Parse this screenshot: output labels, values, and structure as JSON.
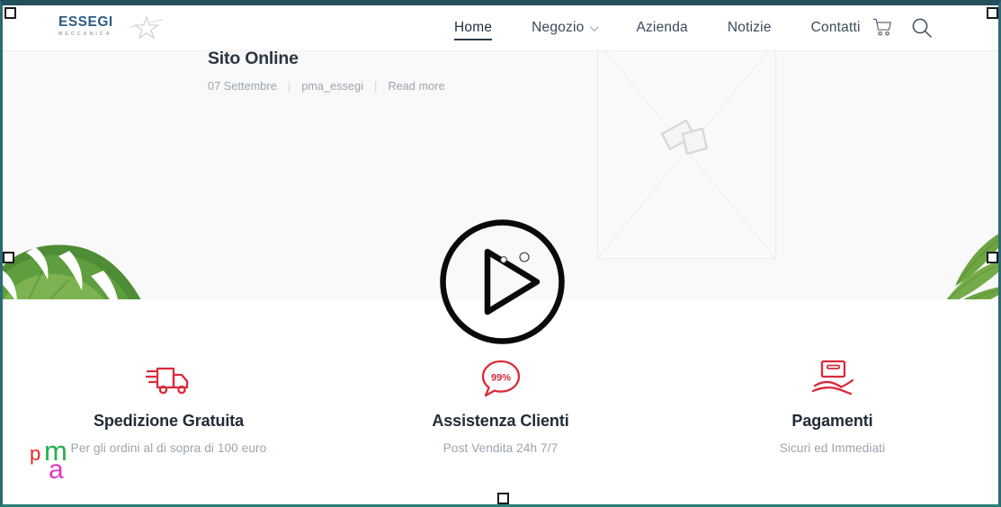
{
  "window": {
    "frame_color": "#24505e",
    "selection_handles": [
      "top-left",
      "top-right",
      "middle-left",
      "middle-right",
      "bottom-center"
    ]
  },
  "header": {
    "brand": {
      "wordmark": "ESSEGI",
      "subtitle": "MECCANICA",
      "wordmark_color": "#2c5d86",
      "star_icon": "star-swoosh-icon"
    },
    "nav": [
      {
        "label": "Home",
        "active": true,
        "has_dropdown": false
      },
      {
        "label": "Negozio",
        "active": false,
        "has_dropdown": true
      },
      {
        "label": "Azienda",
        "active": false,
        "has_dropdown": false
      },
      {
        "label": "Notizie",
        "active": false,
        "has_dropdown": false
      },
      {
        "label": "Contatti",
        "active": false,
        "has_dropdown": false
      }
    ],
    "actions": [
      {
        "icon": "shopping-cart-icon"
      },
      {
        "icon": "search-icon"
      }
    ]
  },
  "blog": {
    "background": "#f9f9f9",
    "post": {
      "title": "Sito Online",
      "date": "07 Settembre",
      "author": "pma_essegi",
      "read_more": "Read more",
      "separator": "|"
    },
    "thumbnail": {
      "state": "broken-image-placeholder",
      "icon": "photo-placeholder-icon"
    }
  },
  "decorations": {
    "left_leaf": "monstera-leaf-icon",
    "right_leaf": "palm-frond-icon"
  },
  "features": {
    "accent_color": "#d92b3a",
    "items": [
      {
        "icon": "delivery-truck-icon",
        "title": "Spedizione Gratuita",
        "subtitle": "Per gli ordini al di sopra di 100 euro"
      },
      {
        "icon": "speech-bubble-99-percent-icon",
        "badge": "99%",
        "title": "Assistenza Clienti",
        "subtitle": "Post Vendita 24h 7/7"
      },
      {
        "icon": "hand-holding-card-icon",
        "title": "Pagamenti",
        "subtitle": "Sicuri ed Immediati"
      }
    ]
  },
  "watermark": {
    "letters": [
      {
        "char": "p",
        "color": "#e8252a"
      },
      {
        "char": "m",
        "color": "#22b14c"
      },
      {
        "char": "a",
        "color": "#e535c4"
      }
    ]
  },
  "cursor": {
    "type": "play-button-cursor",
    "label": "play"
  }
}
